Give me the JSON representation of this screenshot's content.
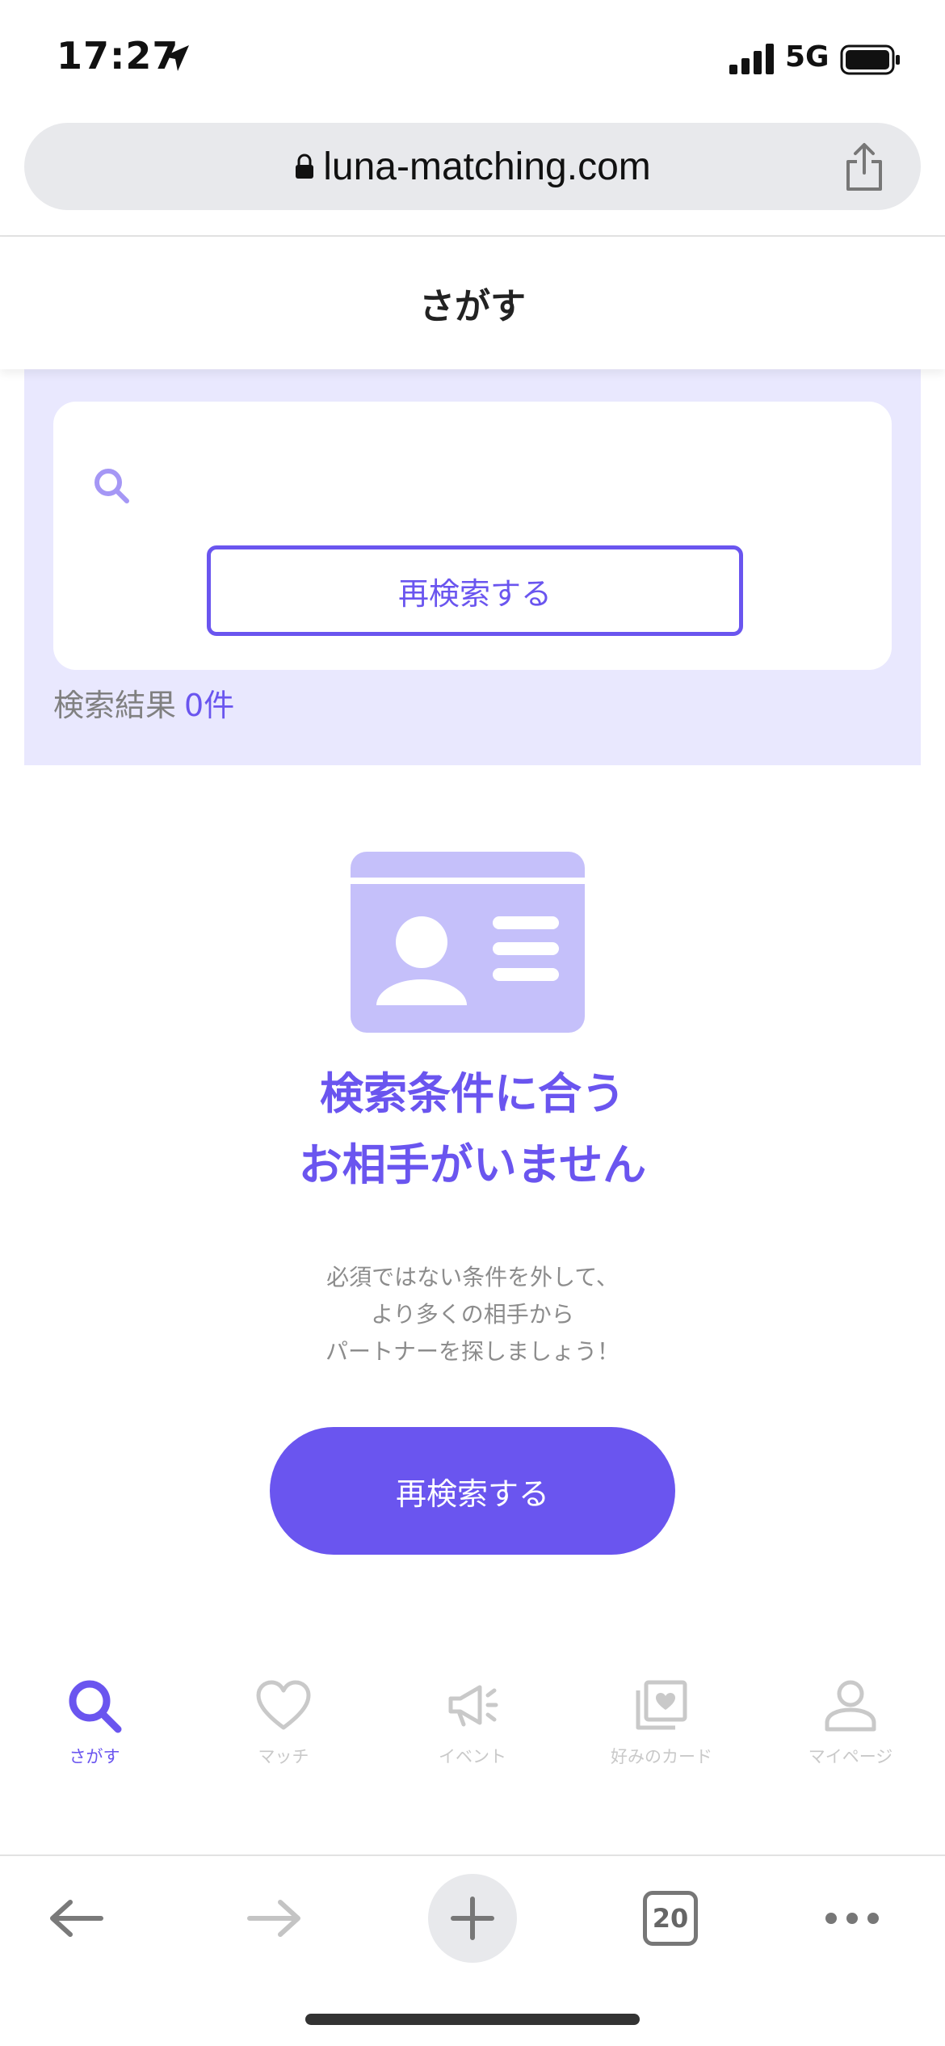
{
  "status_bar": {
    "time": "17:27",
    "network": "5G"
  },
  "browser": {
    "url": "luna-matching.com",
    "tab_count": "20"
  },
  "header": {
    "title": "さがす"
  },
  "search": {
    "button_label": "再検索する",
    "result_label": "検索結果",
    "result_count": "0件"
  },
  "empty_state": {
    "title_line1": "検索条件に合う",
    "title_line2": "お相手がいません",
    "desc_line1": "必須ではない条件を外して、",
    "desc_line2": "より多くの相手から",
    "desc_line3": "パートナーを探しましょう！",
    "button_label": "再検索する"
  },
  "nav": {
    "items": [
      {
        "label": "さがす",
        "icon": "search-icon",
        "active": true
      },
      {
        "label": "マッチ",
        "icon": "heart-icon",
        "active": false
      },
      {
        "label": "イベント",
        "icon": "megaphone-icon",
        "active": false
      },
      {
        "label": "好みのカード",
        "icon": "card-heart-icon",
        "active": false
      },
      {
        "label": "マイページ",
        "icon": "person-icon",
        "active": false
      }
    ]
  },
  "colors": {
    "accent": "#6a55ef",
    "panel_bg": "#e9e8fe",
    "illustration": "#c5c0fa",
    "inactive": "#c9c9c9"
  }
}
